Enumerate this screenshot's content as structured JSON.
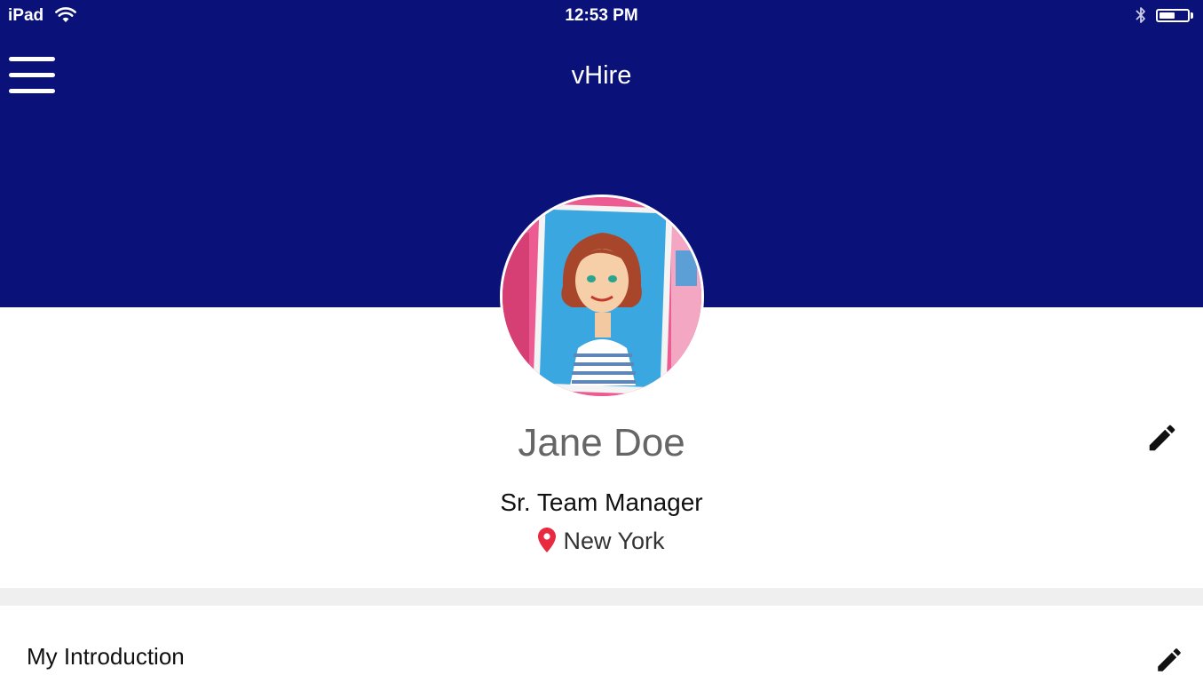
{
  "status_bar": {
    "device": "iPad",
    "time": "12:53 PM",
    "battery_level": 0.55,
    "icons": [
      "wifi-icon",
      "bluetooth-icon",
      "battery-icon"
    ]
  },
  "nav": {
    "title": "vHire",
    "menu_icon": "hamburger-menu-icon"
  },
  "profile": {
    "name": "Jane Doe",
    "job_title": "Sr. Team Manager",
    "location": "New York",
    "location_icon": "map-pin-icon",
    "edit_icon": "pencil-icon"
  },
  "section": {
    "title": "My Introduction",
    "edit_icon": "pencil-icon"
  },
  "colors": {
    "header_bg": "#0a127a",
    "pin": "#e8293f",
    "name_text": "#666666",
    "divider": "#efefef"
  }
}
